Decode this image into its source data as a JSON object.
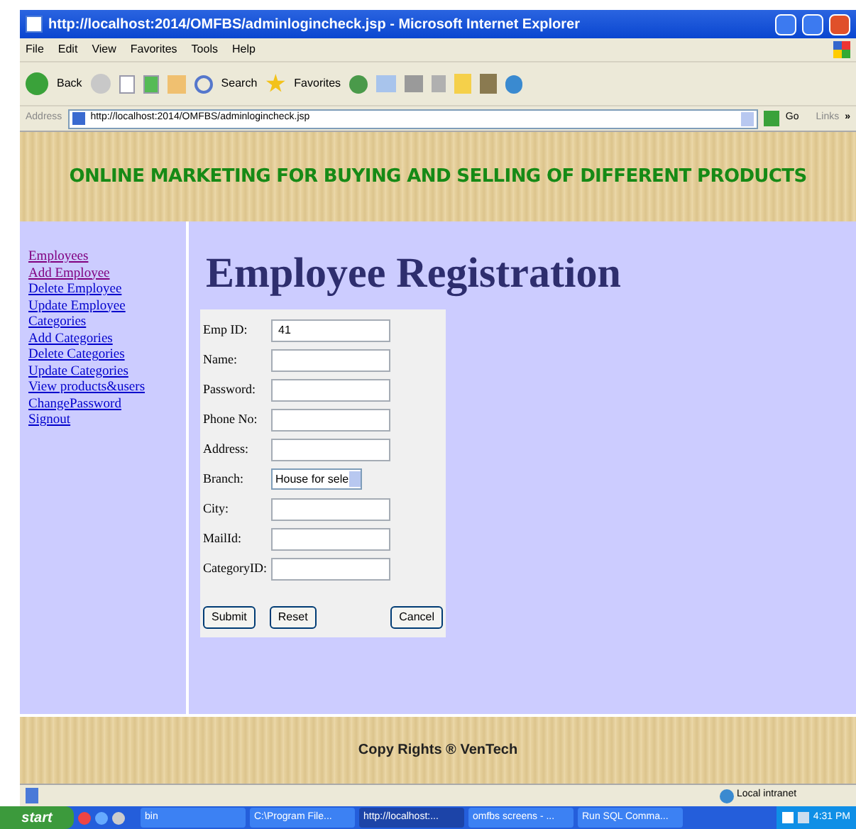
{
  "window": {
    "title": "http://localhost:2014/OMFBS/adminlogincheck.jsp - Microsoft Internet Explorer"
  },
  "menu": [
    "File",
    "Edit",
    "View",
    "Favorites",
    "Tools",
    "Help"
  ],
  "toolbar": {
    "back": "Back",
    "search": "Search",
    "favorites": "Favorites"
  },
  "address_bar": {
    "label": "Address",
    "value": "http://localhost:2014/OMFBS/adminlogincheck.jsp",
    "go": "Go",
    "links": "Links",
    "more": "»"
  },
  "header": {
    "title": "ONLINE MARKETING FOR BUYING AND SELLING OF DIFFERENT PRODUCTS"
  },
  "sidebar": {
    "items": [
      {
        "label": "Employees",
        "visited": true
      },
      {
        "label": "Add Employee",
        "visited": true
      },
      {
        "label": "Delete Employee",
        "visited": false
      },
      {
        "label": "Update Employee",
        "visited": false
      },
      {
        "label": "Categories",
        "visited": false
      },
      {
        "label": "Add Categories",
        "visited": false
      },
      {
        "label": "Delete Categories",
        "visited": false
      },
      {
        "label": "Update Categories",
        "visited": false
      },
      {
        "label": "View products&users",
        "visited": false
      },
      {
        "label": "ChangePassword",
        "visited": false
      },
      {
        "label": "Signout",
        "visited": false
      }
    ]
  },
  "page": {
    "heading": "Employee Registration"
  },
  "form": {
    "fields": [
      {
        "kind": "text",
        "label": "Emp ID:",
        "value": "41"
      },
      {
        "kind": "text",
        "label": "Name:"
      },
      {
        "kind": "text",
        "label": "Password:"
      },
      {
        "kind": "text",
        "label": "Phone No:"
      },
      {
        "kind": "text",
        "label": "Address:"
      },
      {
        "kind": "select",
        "label": "Branch:",
        "value": "House for sele"
      },
      {
        "kind": "text",
        "label": "City:"
      },
      {
        "kind": "text",
        "label": "MailId:"
      },
      {
        "kind": "text",
        "label": "CategoryID:"
      }
    ],
    "buttons": [
      "Submit",
      "Reset",
      "Cancel"
    ]
  },
  "footer": {
    "text": "Copy Rights ® VenTech"
  },
  "status_bar": {
    "zone": "Local intranet"
  },
  "taskbar": {
    "start": "start",
    "tasks": [
      {
        "label": "bin",
        "selected": false
      },
      {
        "label": "C:\\Program File...",
        "selected": false
      },
      {
        "label": "http://localhost:...",
        "selected": true
      },
      {
        "label": "omfbs screens - ...",
        "selected": false
      },
      {
        "label": "Run SQL Comma...",
        "selected": false
      }
    ],
    "clock": "4:31 PM"
  }
}
